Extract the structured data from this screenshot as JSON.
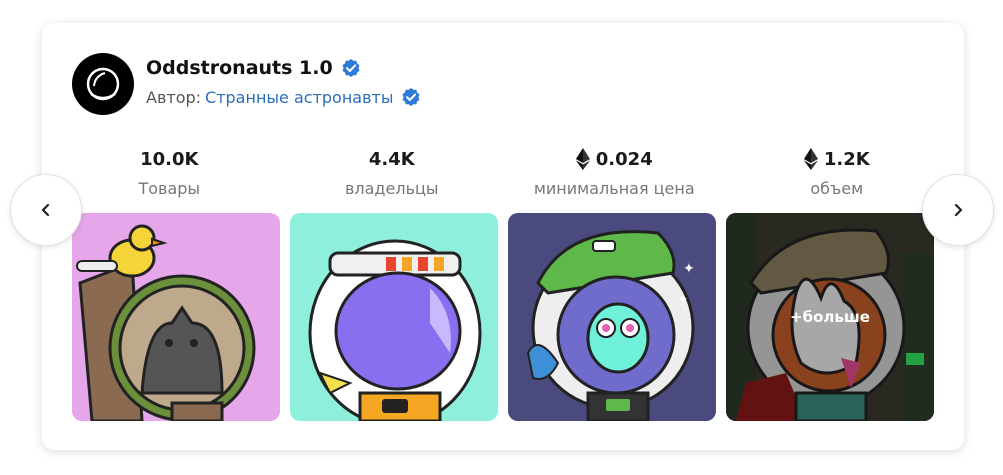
{
  "collection": {
    "name": "Oddstronauts 1.0",
    "author_prefix": "Автор:",
    "author_name": "Странные астронавты",
    "verified_color": "#2f7bd8"
  },
  "stats": [
    {
      "value": "10.0K",
      "label": "Товары",
      "currency_icon": ""
    },
    {
      "value": "4.4K",
      "label": "владельцы",
      "currency_icon": ""
    },
    {
      "value": "0.024",
      "label": "минимальная цена",
      "currency_icon": "ethereum-icon"
    },
    {
      "value": "1.2K",
      "label": "объем",
      "currency_icon": "ethereum-icon"
    }
  ],
  "thumbnails": [
    {
      "name": "astronaut-cat-duck",
      "bg": "#e6a6ea"
    },
    {
      "name": "astronaut-purple-visor",
      "bg": "#8ef0dc"
    },
    {
      "name": "astronaut-owl",
      "bg": "#4a4a7e"
    },
    {
      "name": "astronaut-bunny",
      "bg": "#3a3a2e"
    }
  ],
  "more_label": "+больше",
  "nav": {
    "prev_icon": "chevron-left-icon",
    "next_icon": "chevron-right-icon"
  }
}
